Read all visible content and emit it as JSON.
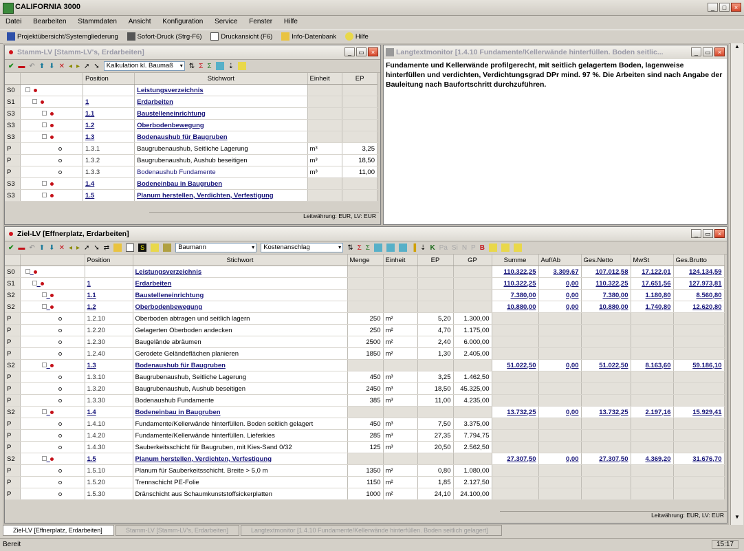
{
  "app": {
    "title": "CALIFORNIA 3000"
  },
  "menu": [
    "Datei",
    "Bearbeiten",
    "Stammdaten",
    "Ansicht",
    "Konfiguration",
    "Service",
    "Fenster",
    "Hilfe"
  ],
  "toolbar": {
    "projekt": "Projektübersicht/Systemgliederung",
    "sofortdruck": "Sofort-Druck (Strg-F6)",
    "druckansicht": "Druckansicht (F6)",
    "infodb": "Info-Datenbank",
    "hilfe": "Hilfe"
  },
  "stamm": {
    "title": "Stamm-LV [Stamm-LV's, Erdarbeiten]",
    "calc_select": "Kalkulation kl. Baumaß",
    "columns": [
      "Position",
      "Stichwort",
      "Einheit",
      "EP"
    ],
    "rows": [
      {
        "typ": "S0",
        "pos": "",
        "text": "Leistungsverzeichnis",
        "einheit": "",
        "ep": "",
        "hdr": true
      },
      {
        "typ": "S1",
        "pos": "1",
        "text": "Erdarbeiten",
        "einheit": "",
        "ep": "",
        "hdr": true
      },
      {
        "typ": "S3",
        "pos": "1.1",
        "text": "Baustelleneinrichtung",
        "einheit": "",
        "ep": "",
        "hdr": true
      },
      {
        "typ": "S3",
        "pos": "1.2",
        "text": "Oberbodenbewegung",
        "einheit": "",
        "ep": "",
        "hdr": true
      },
      {
        "typ": "S3",
        "pos": "1.3",
        "text": "Bodenaushub für Baugruben",
        "einheit": "",
        "ep": "",
        "hdr": true
      },
      {
        "typ": "P",
        "pos": "1.3.1",
        "text": "Baugrubenaushub, Seitliche Lagerung",
        "einheit": "m³",
        "ep": "3,25",
        "hdr": false
      },
      {
        "typ": "P",
        "pos": "1.3.2",
        "text": "Baugrubenaushub, Aushub beseitigen",
        "einheit": "m³",
        "ep": "18,50",
        "hdr": false
      },
      {
        "typ": "P",
        "pos": "1.3.3",
        "text": "Bodenaushub Fundamente",
        "einheit": "m³",
        "ep": "11,00",
        "hdr": false
      },
      {
        "typ": "S3",
        "pos": "1.4",
        "text": "Bodeneinbau in Baugruben",
        "einheit": "",
        "ep": "",
        "hdr": true
      },
      {
        "typ": "S3",
        "pos": "1.5",
        "text": "Planum herstellen, Verdichten, Verfestigung",
        "einheit": "",
        "ep": "",
        "hdr": true
      }
    ],
    "status": "Leitwährung: EUR, LV: EUR"
  },
  "langtext": {
    "title": "Langtextmonitor [1.4.10 Fundamente/Kellerwände hinterfüllen. Boden seitlic...",
    "body": "Fundamente und Kellerwände profilgerecht, mit seitlich gelagertem Boden, lagenweise hinterfüllen und verdichten, Verdichtungsgrad DPr mind. 97 %. Die Arbeiten sind nach Angabe der Bauleitung nach Baufortschritt durchzuführen."
  },
  "ziel": {
    "title": "Ziel-LV [Effnerplatz, Erdarbeiten]",
    "select1": "Baumann",
    "select2": "Kostenanschlag",
    "columns": [
      "Position",
      "Stichwort",
      "Menge",
      "Einheit",
      "EP",
      "GP",
      "Summe",
      "Auf/Ab",
      "Ges.Netto",
      "MwSt",
      "Ges.Brutto"
    ],
    "rows": [
      {
        "typ": "S0",
        "pos": "",
        "text": "Leistungsverzeichnis",
        "menge": "",
        "einheit": "",
        "ep": "",
        "gp": "",
        "summe": "110.322,25",
        "aufab": "3.309,67",
        "netto": "107.012,58",
        "mwst": "17.122,01",
        "brutto": "124.134,59",
        "hdr": true
      },
      {
        "typ": "S1",
        "pos": "1",
        "text": "Erdarbeiten",
        "menge": "",
        "einheit": "",
        "ep": "",
        "gp": "",
        "summe": "110.322,25",
        "aufab": "0,00",
        "netto": "110.322,25",
        "mwst": "17.651,56",
        "brutto": "127.973,81",
        "hdr": true
      },
      {
        "typ": "S2",
        "pos": "1.1",
        "text": "Baustelleneinrichtung",
        "menge": "",
        "einheit": "",
        "ep": "",
        "gp": "",
        "summe": "7.380,00",
        "aufab": "0,00",
        "netto": "7.380,00",
        "mwst": "1.180,80",
        "brutto": "8.560,80",
        "hdr": true
      },
      {
        "typ": "S2",
        "pos": "1.2",
        "text": "Oberbodenbewegung",
        "menge": "",
        "einheit": "",
        "ep": "",
        "gp": "",
        "summe": "10.880,00",
        "aufab": "0,00",
        "netto": "10.880,00",
        "mwst": "1.740,80",
        "brutto": "12.620,80",
        "hdr": true
      },
      {
        "typ": "P",
        "pos": "1.2.10",
        "text": "Oberboden abtragen und seitlich lagern",
        "menge": "250",
        "einheit": "m²",
        "ep": "5,20",
        "gp": "1.300,00",
        "summe": "",
        "aufab": "",
        "netto": "",
        "mwst": "",
        "brutto": "",
        "hdr": false
      },
      {
        "typ": "P",
        "pos": "1.2.20",
        "text": "Gelagerten Oberboden andecken",
        "menge": "250",
        "einheit": "m²",
        "ep": "4,70",
        "gp": "1.175,00",
        "summe": "",
        "aufab": "",
        "netto": "",
        "mwst": "",
        "brutto": "",
        "hdr": false
      },
      {
        "typ": "P",
        "pos": "1.2.30",
        "text": "Baugelände abräumen",
        "menge": "2500",
        "einheit": "m²",
        "ep": "2,40",
        "gp": "6.000,00",
        "summe": "",
        "aufab": "",
        "netto": "",
        "mwst": "",
        "brutto": "",
        "hdr": false
      },
      {
        "typ": "P",
        "pos": "1.2.40",
        "text": "Gerodete Geländeflächen planieren",
        "menge": "1850",
        "einheit": "m²",
        "ep": "1,30",
        "gp": "2.405,00",
        "summe": "",
        "aufab": "",
        "netto": "",
        "mwst": "",
        "brutto": "",
        "hdr": false
      },
      {
        "typ": "S2",
        "pos": "1.3",
        "text": "Bodenaushub für Baugruben",
        "menge": "",
        "einheit": "",
        "ep": "",
        "gp": "",
        "summe": "51.022,50",
        "aufab": "0,00",
        "netto": "51.022,50",
        "mwst": "8.163,60",
        "brutto": "59.186,10",
        "hdr": true
      },
      {
        "typ": "P",
        "pos": "1.3.10",
        "text": "Baugrubenaushub, Seitliche Lagerung",
        "menge": "450",
        "einheit": "m³",
        "ep": "3,25",
        "gp": "1.462,50",
        "summe": "",
        "aufab": "",
        "netto": "",
        "mwst": "",
        "brutto": "",
        "hdr": false
      },
      {
        "typ": "P",
        "pos": "1.3.20",
        "text": "Baugrubenaushub, Aushub beseitigen",
        "menge": "2450",
        "einheit": "m³",
        "ep": "18,50",
        "gp": "45.325,00",
        "summe": "",
        "aufab": "",
        "netto": "",
        "mwst": "",
        "brutto": "",
        "hdr": false
      },
      {
        "typ": "P",
        "pos": "1.3.30",
        "text": "Bodenaushub Fundamente",
        "menge": "385",
        "einheit": "m³",
        "ep": "11,00",
        "gp": "4.235,00",
        "summe": "",
        "aufab": "",
        "netto": "",
        "mwst": "",
        "brutto": "",
        "hdr": false
      },
      {
        "typ": "S2",
        "pos": "1.4",
        "text": "Bodeneinbau in Baugruben",
        "menge": "",
        "einheit": "",
        "ep": "",
        "gp": "",
        "summe": "13.732,25",
        "aufab": "0,00",
        "netto": "13.732,25",
        "mwst": "2.197,16",
        "brutto": "15.929,41",
        "hdr": true
      },
      {
        "typ": "P",
        "pos": "1.4.10",
        "text": "Fundamente/Kellerwände hinterfüllen. Boden seitlich gelagert",
        "menge": "450",
        "einheit": "m³",
        "ep": "7,50",
        "gp": "3.375,00",
        "summe": "",
        "aufab": "",
        "netto": "",
        "mwst": "",
        "brutto": "",
        "hdr": false
      },
      {
        "typ": "P",
        "pos": "1.4.20",
        "text": "Fundamente/Kellerwände hinterfüllen. Lieferkies",
        "menge": "285",
        "einheit": "m³",
        "ep": "27,35",
        "gp": "7.794,75",
        "summe": "",
        "aufab": "",
        "netto": "",
        "mwst": "",
        "brutto": "",
        "hdr": false
      },
      {
        "typ": "P",
        "pos": "1.4.30",
        "text": "Sauberkeitsschicht für Baugruben, mit Kies-Sand 0/32",
        "menge": "125",
        "einheit": "m³",
        "ep": "20,50",
        "gp": "2.562,50",
        "summe": "",
        "aufab": "",
        "netto": "",
        "mwst": "",
        "brutto": "",
        "hdr": false
      },
      {
        "typ": "S2",
        "pos": "1.5",
        "text": "Planum herstellen, Verdichten, Verfestigung",
        "menge": "",
        "einheit": "",
        "ep": "",
        "gp": "",
        "summe": "27.307,50",
        "aufab": "0,00",
        "netto": "27.307,50",
        "mwst": "4.369,20",
        "brutto": "31.676,70",
        "hdr": true
      },
      {
        "typ": "P",
        "pos": "1.5.10",
        "text": "Planum für Sauberkeitsschicht. Breite > 5,0 m",
        "menge": "1350",
        "einheit": "m²",
        "ep": "0,80",
        "gp": "1.080,00",
        "summe": "",
        "aufab": "",
        "netto": "",
        "mwst": "",
        "brutto": "",
        "hdr": false
      },
      {
        "typ": "P",
        "pos": "1.5.20",
        "text": "Trennschicht PE-Folie",
        "menge": "1150",
        "einheit": "m²",
        "ep": "1,85",
        "gp": "2.127,50",
        "summe": "",
        "aufab": "",
        "netto": "",
        "mwst": "",
        "brutto": "",
        "hdr": false
      },
      {
        "typ": "P",
        "pos": "1.5.30",
        "text": "Dränschicht aus Schaumkunststoffsickerplatten",
        "menge": "1000",
        "einheit": "m²",
        "ep": "24,10",
        "gp": "24.100,00",
        "summe": "",
        "aufab": "",
        "netto": "",
        "mwst": "",
        "brutto": "",
        "hdr": false
      }
    ],
    "status": "Leitwährung: EUR, LV: EUR"
  },
  "tabs": [
    "Ziel-LV [Effnerplatz, Erdarbeiten]",
    "Stamm-LV [Stamm-LV's, Erdarbeiten]",
    "Langtextmonitor [1.4.10 Fundamente/Kellerwände hinterfüllen. Boden seitlich gelagert]"
  ],
  "status": {
    "left": "Bereit",
    "time": "15:17"
  },
  "colors": {
    "link": "#17157a",
    "red": "#c41018",
    "bg": "#d4d0c8"
  }
}
